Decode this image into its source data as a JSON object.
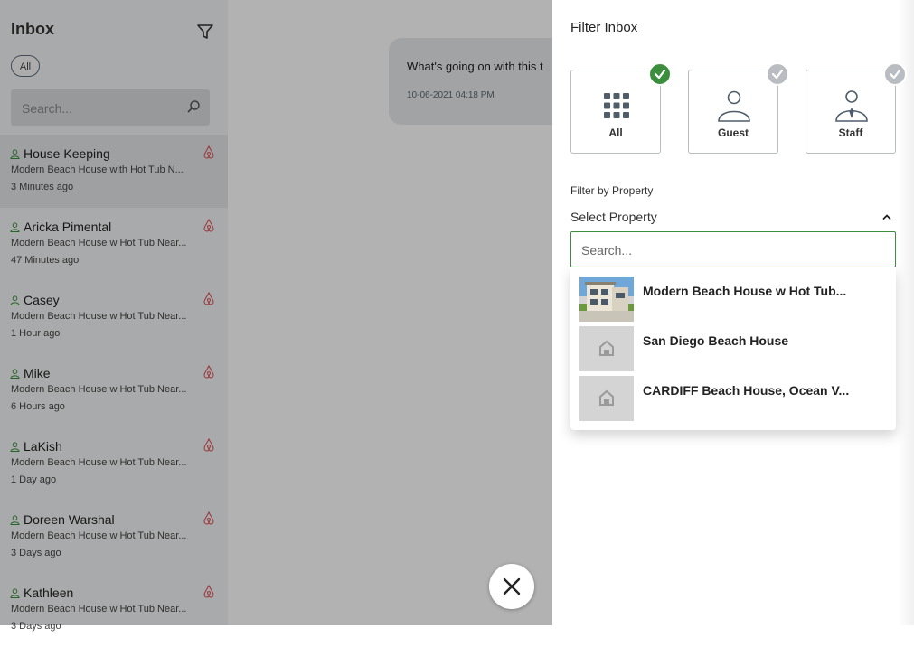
{
  "sidebar": {
    "title": "Inbox",
    "chip_all": "All",
    "search_placeholder": "Search...",
    "conversations": [
      {
        "name": "House Keeping",
        "property": "Modern Beach House with Hot Tub N...",
        "time": "3 Minutes ago"
      },
      {
        "name": "Aricka Pimental",
        "property": "Modern Beach House w Hot Tub Near...",
        "time": "47 Minutes ago"
      },
      {
        "name": "Casey",
        "property": "Modern Beach House w Hot Tub Near...",
        "time": "1 Hour ago"
      },
      {
        "name": "Mike",
        "property": "Modern Beach House w Hot Tub Near...",
        "time": "6 Hours ago"
      },
      {
        "name": "LaKish",
        "property": "Modern Beach House w Hot Tub Near...",
        "time": "1 Day ago"
      },
      {
        "name": "Doreen Warshal",
        "property": "Modern Beach House w Hot Tub Near...",
        "time": "3 Days ago"
      },
      {
        "name": "Kathleen",
        "property": "Modern Beach House w Hot Tub Near...",
        "time": "3 Days ago"
      }
    ]
  },
  "message": {
    "text": "What's going on with this t",
    "timestamp": "10-06-2021 04:18 PM"
  },
  "filter_panel": {
    "title": "Filter Inbox",
    "types": [
      {
        "label": "All",
        "checked": true
      },
      {
        "label": "Guest",
        "checked": false
      },
      {
        "label": "Staff",
        "checked": false
      }
    ],
    "property_label": "Filter by Property",
    "select_placeholder": "Select Property",
    "search_placeholder": "Search...",
    "properties": [
      {
        "name": "Modern Beach House w Hot Tub...",
        "has_photo": true
      },
      {
        "name": "San Diego Beach House",
        "has_photo": false
      },
      {
        "name": "CARDIFF Beach House, Ocean V...",
        "has_photo": false
      }
    ]
  },
  "colors": {
    "accent_green": "#3a8e3d",
    "airbnb_red": "#e0484f",
    "muted_gray": "#b9bdc2"
  }
}
